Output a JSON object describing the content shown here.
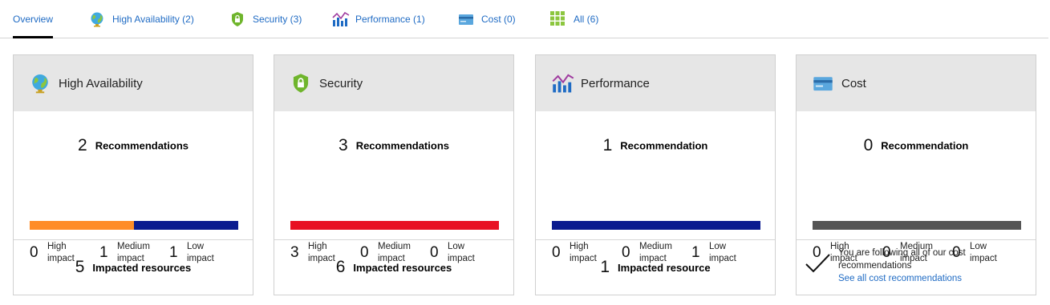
{
  "tabs": [
    {
      "label": "Overview",
      "icon": "none",
      "active": true
    },
    {
      "label": "High Availability (2)",
      "icon": "globe-icon"
    },
    {
      "label": "Security (3)",
      "icon": "shield-lock-icon"
    },
    {
      "label": "Performance (1)",
      "icon": "performance-chart-icon"
    },
    {
      "label": "Cost (0)",
      "icon": "credit-card-icon"
    },
    {
      "label": "All (6)",
      "icon": "grid-icon"
    }
  ],
  "colors": {
    "link": "#1f6bc4",
    "high": "#e81123",
    "medium": "#ff8c28",
    "low": "#0b1b8f",
    "none": "#555555",
    "header_bg": "#e6e6e6"
  },
  "cards": {
    "ha": {
      "title": "High Availability",
      "icon": "globe-icon",
      "rec_count": "2",
      "rec_label": "Recommendations",
      "impact_share": {
        "high": 0,
        "medium": 0.5,
        "low": 0.5
      },
      "impacts": [
        {
          "count": "0",
          "label": "High impact"
        },
        {
          "count": "1",
          "label": "Medium impact"
        },
        {
          "count": "1",
          "label": "Low impact"
        }
      ],
      "resources_count": "5",
      "resources_label": "Impacted resources"
    },
    "security": {
      "title": "Security",
      "icon": "shield-lock-icon",
      "rec_count": "3",
      "rec_label": "Recommendations",
      "impact_share": {
        "high": 1,
        "medium": 0,
        "low": 0
      },
      "impacts": [
        {
          "count": "3",
          "label": "High impact"
        },
        {
          "count": "0",
          "label": "Medium impact"
        },
        {
          "count": "0",
          "label": "Low impact"
        }
      ],
      "resources_count": "6",
      "resources_label": "Impacted resources"
    },
    "performance": {
      "title": "Performance",
      "icon": "performance-chart-icon",
      "rec_count": "1",
      "rec_label": "Recommendation",
      "impact_share": {
        "high": 0,
        "medium": 0,
        "low": 1
      },
      "impacts": [
        {
          "count": "0",
          "label": "High impact"
        },
        {
          "count": "0",
          "label": "Medium impact"
        },
        {
          "count": "1",
          "label": "Low impact"
        }
      ],
      "resources_count": "1",
      "resources_label": "Impacted resource"
    },
    "cost": {
      "title": "Cost",
      "icon": "credit-card-icon",
      "rec_count": "0",
      "rec_label": "Recommendation",
      "impact_share": {
        "high": 0,
        "medium": 0,
        "low": 0
      },
      "impacts": [
        {
          "count": "0",
          "label": "High impact"
        },
        {
          "count": "0",
          "label": "Medium impact"
        },
        {
          "count": "0",
          "label": "Low impact"
        }
      ],
      "following_text": "You are following all of our cost recommendations",
      "following_link": "See all cost recommendations"
    }
  }
}
